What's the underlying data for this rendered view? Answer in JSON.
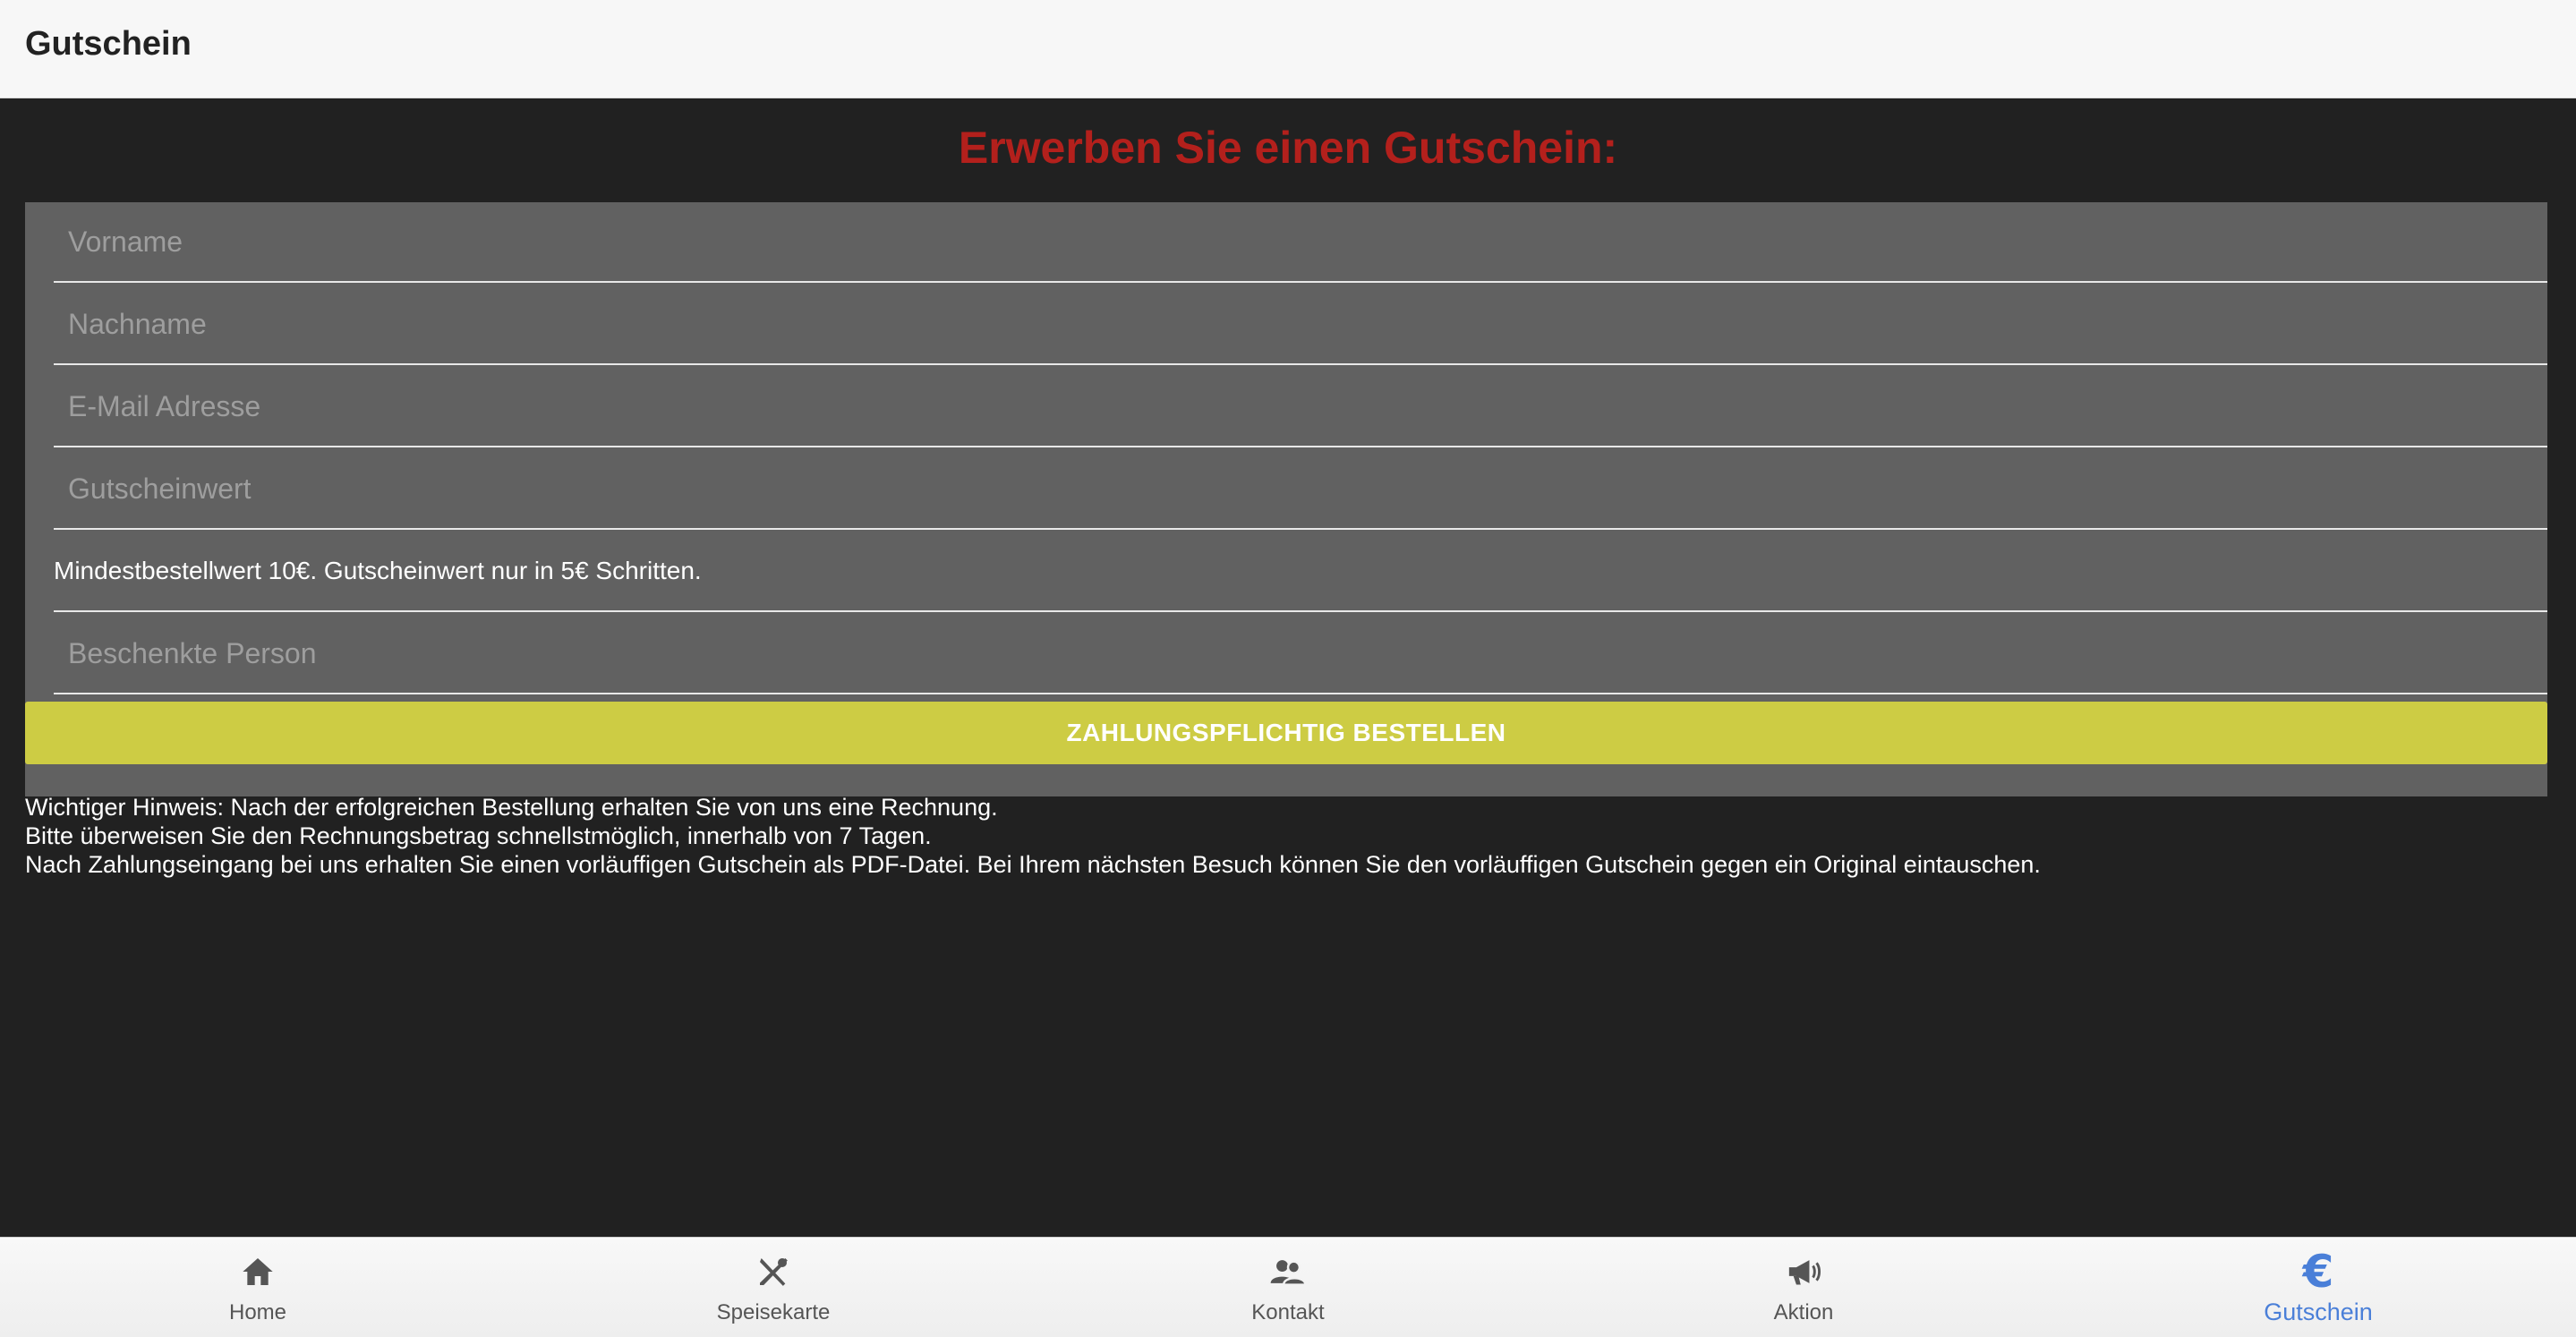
{
  "header": {
    "title": "Gutschein"
  },
  "main": {
    "heading": "Erwerben Sie einen Gutschein:",
    "heading_color": "#b3201c",
    "form": {
      "first_name": {
        "value": "",
        "placeholder": "Vorname"
      },
      "last_name": {
        "value": "",
        "placeholder": "Nachname"
      },
      "email": {
        "value": "",
        "placeholder": "E-Mail Adresse"
      },
      "voucher_value": {
        "value": "",
        "placeholder": "Gutscheinwert"
      },
      "voucher_hint": "Mindestbestellwert 10€. Gutscheinwert nur in 5€ Schritten.",
      "recipient": {
        "value": "",
        "placeholder": "Beschenkte Person"
      }
    },
    "order_button_label": "ZAHLUNGSPFLICHTIG BESTELLEN",
    "order_button_color": "#cdcc44",
    "notice": {
      "line1": "Wichtiger Hinweis: Nach der erfolgreichen Bestellung erhalten Sie von uns eine Rechnung.",
      "line2": "Bitte überweisen Sie den Rechnungsbetrag schnellstmöglich, innerhalb von 7 Tagen.",
      "line3": "Nach Zahlungseingang bei uns erhalten Sie einen vorläuffigen Gutschein als PDF-Datei. Bei Ihrem nächsten Besuch können Sie den vorläuffigen Gutschein gegen ein Original eintauschen."
    }
  },
  "bottom_nav": {
    "active_color": "#4a7fd8",
    "items": [
      {
        "label": "Home",
        "icon": "home-icon"
      },
      {
        "label": "Speisekarte",
        "icon": "cutlery-icon"
      },
      {
        "label": "Kontakt",
        "icon": "contacts-icon"
      },
      {
        "label": "Aktion",
        "icon": "megaphone-icon"
      },
      {
        "label": "Gutschein",
        "icon": "euro-icon",
        "active": true
      }
    ]
  }
}
